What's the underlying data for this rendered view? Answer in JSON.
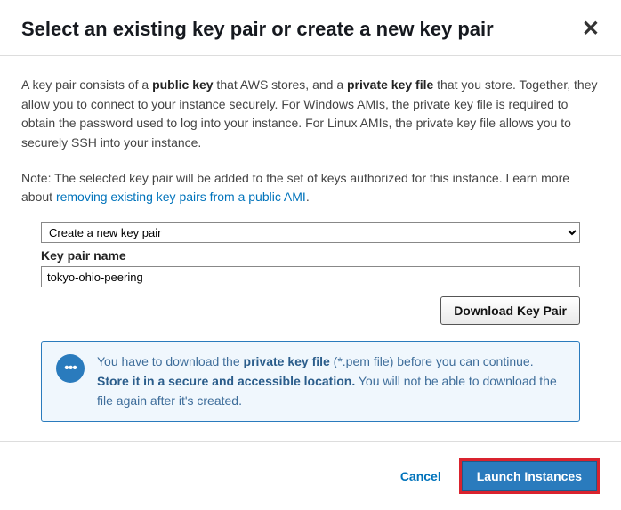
{
  "header": {
    "title": "Select an existing key pair or create a new key pair",
    "close_glyph": "✕"
  },
  "desc": {
    "p1a": "A key pair consists of a ",
    "p1b": "public key",
    "p1c": " that AWS stores, and a ",
    "p1d": "private key file",
    "p1e": " that you store. Together, they allow you to connect to your instance securely. For Windows AMIs, the private key file is required to obtain the password used to log into your instance. For Linux AMIs, the private key file allows you to securely SSH into your instance."
  },
  "note": {
    "text": "Note: The selected key pair will be added to the set of keys authorized for this instance. Learn more about ",
    "link": "removing existing key pairs from a public AMI",
    "suffix": "."
  },
  "form": {
    "select_value": "Create a new key pair",
    "label": "Key pair name",
    "input_value": "tokyo-ohio-peering",
    "download_label": "Download Key Pair"
  },
  "alert": {
    "t1": "You have to download the ",
    "t2": "private key file",
    "t3": " (*.pem file) before you can continue. ",
    "t4": "Store it in a secure and accessible location.",
    "t5": " You will not be able to download the file again after it's created."
  },
  "footer": {
    "cancel": "Cancel",
    "launch": "Launch Instances"
  }
}
